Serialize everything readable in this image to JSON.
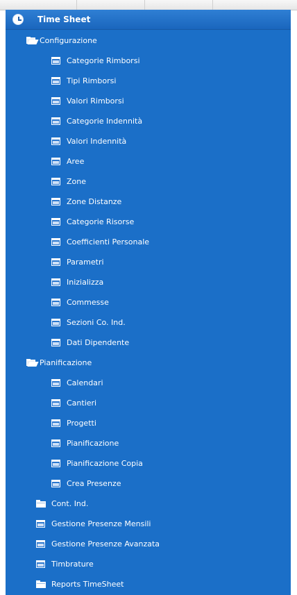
{
  "panel": {
    "title": "Time Sheet"
  },
  "tree": {
    "configurazione": {
      "label": "Configurazione",
      "items": [
        "Categorie Rimborsi",
        "Tipi Rimborsi",
        "Valori Rimborsi",
        "Categorie Indennità",
        "Valori Indennità",
        "Aree",
        "Zone",
        "Zone Distanze",
        "Categorie Risorse",
        "Coefficienti Personale",
        "Parametri",
        "Inizializza",
        "Commesse",
        "Sezioni Co. Ind.",
        "Dati Dipendente"
      ]
    },
    "pianificazione": {
      "label": "Pianificazione",
      "items": [
        "Calendari",
        "Cantieri",
        "Progetti",
        "Pianificazione",
        "Pianificazione Copia",
        "Crea Presenze"
      ]
    },
    "cont_ind": "Cont. Ind.",
    "gestione_mensili": "Gestione Presenze Mensili",
    "gestione_avanzata": "Gestione Presenze Avanzata",
    "timbrature": "Timbrature",
    "reports": "Reports TimeSheet"
  },
  "colors": {
    "panel_bg": "#1b6fc8",
    "header_bg": "#2f7fd4",
    "text": "#ffffff"
  }
}
